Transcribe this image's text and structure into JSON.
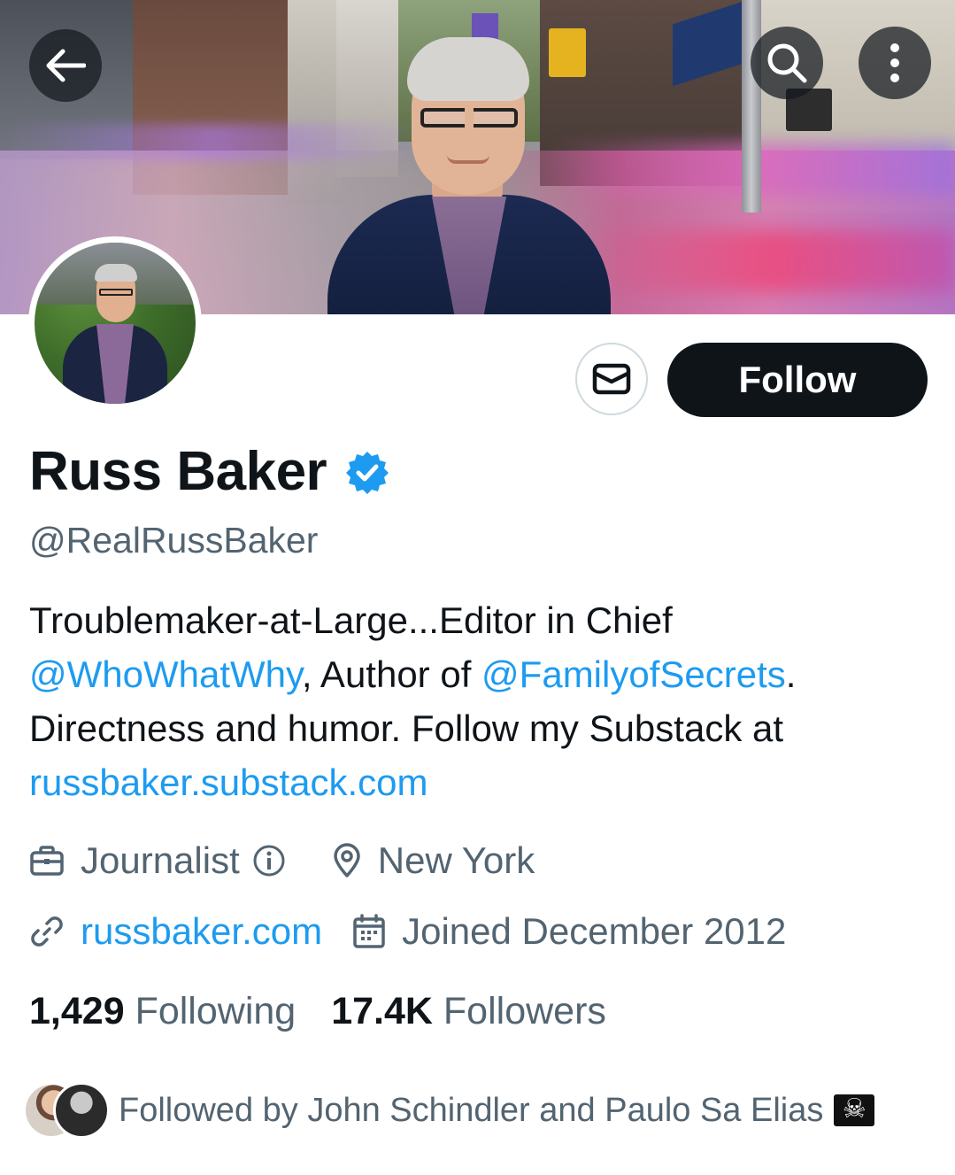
{
  "profile": {
    "name": "Russ Baker",
    "handle": "@RealRussBaker",
    "bio": {
      "line1": "Troublemaker-at-Large...Editor in Chief",
      "mention1": "@WhoWhatWhy",
      "mid": ", Author of ",
      "mention2": "@FamilyofSecrets",
      "after_mention2": ".",
      "line3": "Directness and humor. Follow my Substack at",
      "substack_link": "russbaker.substack.com"
    },
    "category": "Journalist",
    "location": "New York",
    "website": "russbaker.com",
    "joined": "Joined December 2012"
  },
  "actions": {
    "follow_label": "Follow"
  },
  "stats": {
    "following_count": "1,429",
    "following_label": "Following",
    "followers_count": "17.4K",
    "followers_label": "Followers"
  },
  "followed_by": {
    "text": "Followed by John Schindler and Paulo Sa Elias"
  },
  "colors": {
    "link": "#1d9bf0",
    "verified": "#1d9bf0",
    "secondary_text": "#536471",
    "primary_text": "#0f1419"
  },
  "icons": [
    "back-arrow-icon",
    "search-icon",
    "more-vertical-icon",
    "mail-icon",
    "verified-badge-icon",
    "briefcase-icon",
    "info-icon",
    "location-pin-icon",
    "link-icon",
    "calendar-icon",
    "pirate-flag-icon"
  ]
}
